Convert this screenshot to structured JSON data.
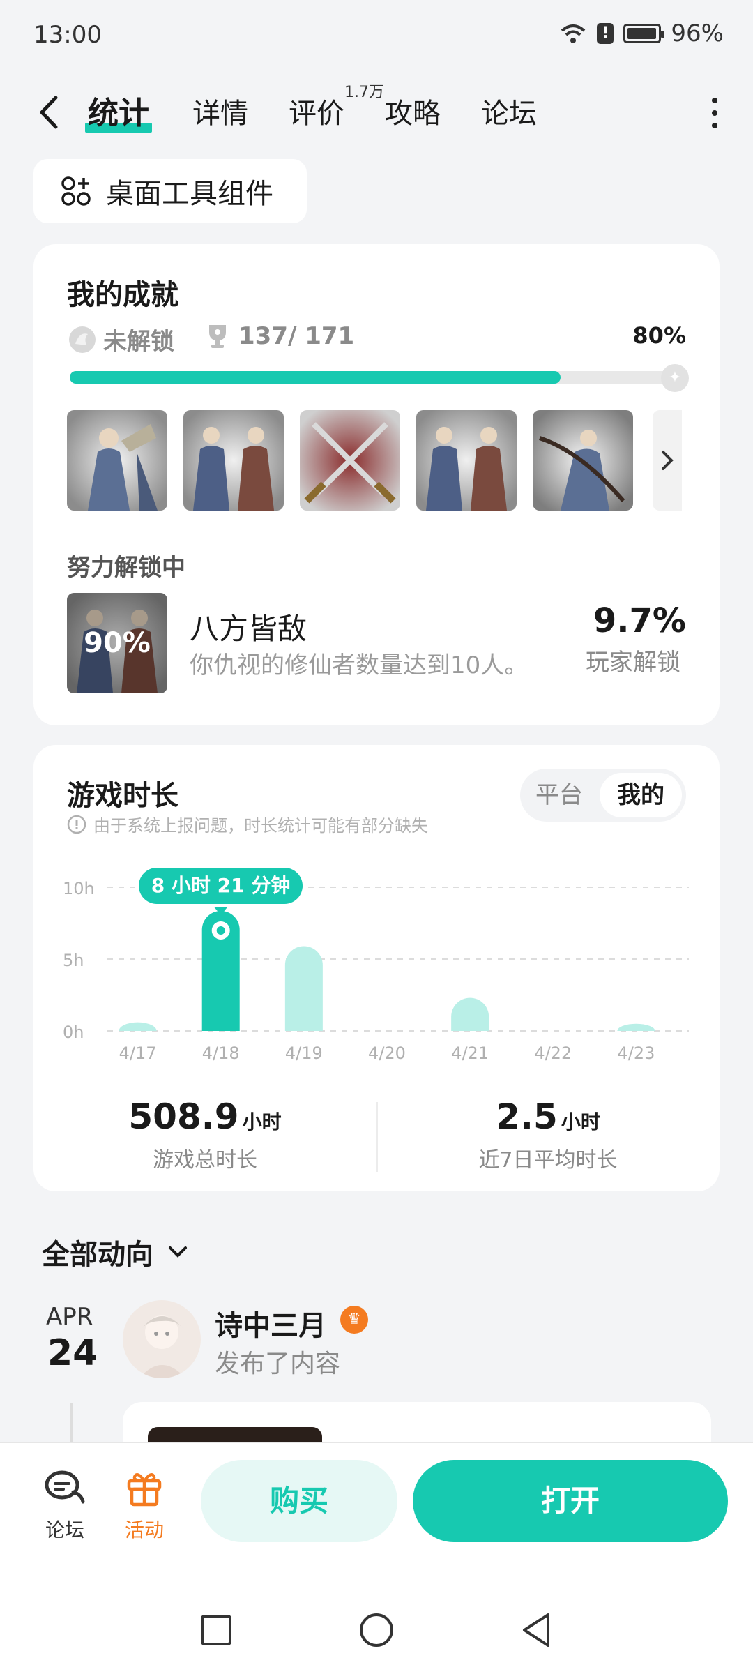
{
  "status_bar": {
    "time": "13:00",
    "battery": "96%",
    "battery_level": 0.96
  },
  "nav": {
    "tabs": [
      {
        "label": "统计",
        "active": true
      },
      {
        "label": "详情"
      },
      {
        "label": "评价",
        "badge": "1.7万"
      },
      {
        "label": "攻略"
      },
      {
        "label": "论坛"
      }
    ]
  },
  "widget_button": {
    "label": "桌面工具组件"
  },
  "achievements": {
    "title": "我的成就",
    "locked_label": "未解锁",
    "count": "137/ 171",
    "percent": "80%",
    "progress": 0.8,
    "in_progress_title": "努力解锁中",
    "current": {
      "progress": "90%",
      "name": "八方皆敌",
      "desc": "你仇视的修仙者数量达到10人。",
      "rate": "9.7%",
      "rate_label": "玩家解锁"
    },
    "colors": {
      "accent": "#17c9b0"
    }
  },
  "playtime": {
    "title": "游戏时长",
    "notice": "由于系统上报问题，时长统计可能有部分缺失",
    "segment": {
      "platform": "平台",
      "mine": "我的",
      "selected": "我的"
    },
    "tooltip": "8 小时 21 分钟",
    "total_value": "508.9",
    "total_unit": "小时",
    "total_label": "游戏总时长",
    "avg_value": "2.5",
    "avg_unit": "小时",
    "avg_label": "近7日平均时长",
    "chart_data": {
      "type": "bar",
      "categories": [
        "4/17",
        "4/18",
        "4/19",
        "4/20",
        "4/21",
        "4/22",
        "4/23"
      ],
      "values": [
        0.6,
        8.35,
        5.9,
        0,
        2.3,
        0,
        0.5
      ],
      "highlight_index": 1,
      "y_ticks": [
        "0h",
        "5h",
        "10h"
      ],
      "ylim": [
        0,
        10
      ],
      "grid": true
    }
  },
  "feed": {
    "title": "全部动向",
    "month": "APR",
    "day": "24",
    "user": "诗中三月",
    "action": "发布了内容"
  },
  "bottom": {
    "forum": "论坛",
    "activity": "活动",
    "buy": "购买",
    "open": "打开"
  }
}
